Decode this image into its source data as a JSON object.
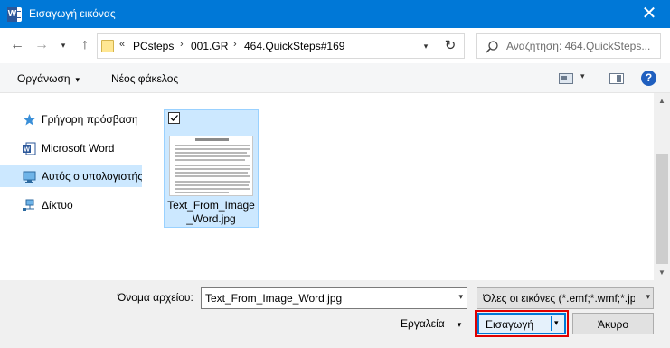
{
  "window": {
    "title": "Εισαγωγή εικόνας",
    "app_icon": "word-icon",
    "close_glyph": "✕"
  },
  "nav": {
    "back_glyph": "←",
    "forward_glyph": "→",
    "recent_glyph": "▾",
    "up_glyph": "↑"
  },
  "address": {
    "overflow": "«",
    "crumbs": [
      "PCsteps",
      "001.GR",
      "464.QuickSteps#169"
    ],
    "separator": "›",
    "dropdown_glyph": "▾",
    "refresh_glyph": "↻"
  },
  "search": {
    "placeholder": "Αναζήτηση: 464.QuickSteps..."
  },
  "toolbar": {
    "organize_label": "Οργάνωση",
    "organize_caret": "▾",
    "new_folder_label": "Νέος φάκελος",
    "view_dd_glyph": "▾",
    "help_label": "?"
  },
  "sidebar": {
    "items": [
      {
        "label": "Γρήγορη πρόσβαση",
        "icon": "star-icon"
      },
      {
        "label": "Microsoft Word",
        "icon": "word-icon"
      },
      {
        "label": "Αυτός ο υπολογιστής",
        "icon": "computer-icon",
        "selected": true
      },
      {
        "label": "Δίκτυο",
        "icon": "network-icon"
      }
    ]
  },
  "files": [
    {
      "name": "Text_From_Image_Word.jpg",
      "name_line1": "Text_From_Image",
      "name_line2": "_Word.jpg",
      "checked": true,
      "selected": true
    }
  ],
  "scroll": {
    "up_glyph": "▲",
    "down_glyph": "▼"
  },
  "footer": {
    "filename_label": "Όνομα αρχείου:",
    "filename_value": "Text_From_Image_Word.jpg",
    "filename_dd_glyph": "▾",
    "filter_value": "Όλες οι εικόνες (*.emf;*.wmf;*.jpg",
    "filter_dd_glyph": "▾",
    "tools_label": "Εργαλεία",
    "tools_caret": "▾",
    "insert_label": "Εισαγωγή",
    "insert_dd_glyph": "▾",
    "cancel_label": "Άκυρο"
  },
  "colors": {
    "titlebar": "#0078d7",
    "selection": "#cce8ff",
    "highlight_box": "#e00000",
    "word_blue": "#2b579a"
  }
}
